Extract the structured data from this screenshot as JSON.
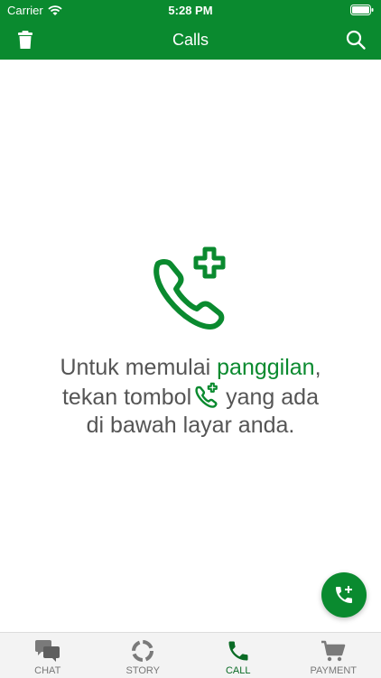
{
  "status": {
    "carrier": "Carrier",
    "time": "5:28 PM"
  },
  "header": {
    "title": "Calls"
  },
  "empty": {
    "line1_pre": "Untuk memulai ",
    "line1_accent": "panggilan",
    "line1_post": ",",
    "line2_pre": "tekan tombol",
    "line2_post": "yang ada",
    "line3": "di bawah layar anda."
  },
  "tabs": [
    {
      "label": "CHAT",
      "icon": "chat-icon"
    },
    {
      "label": "STORY",
      "icon": "story-icon"
    },
    {
      "label": "CALL",
      "icon": "call-icon",
      "active": true
    },
    {
      "label": "PAYMENT",
      "icon": "cart-icon"
    }
  ],
  "colors": {
    "brand": "#0a8a2f",
    "text": "#555555"
  }
}
